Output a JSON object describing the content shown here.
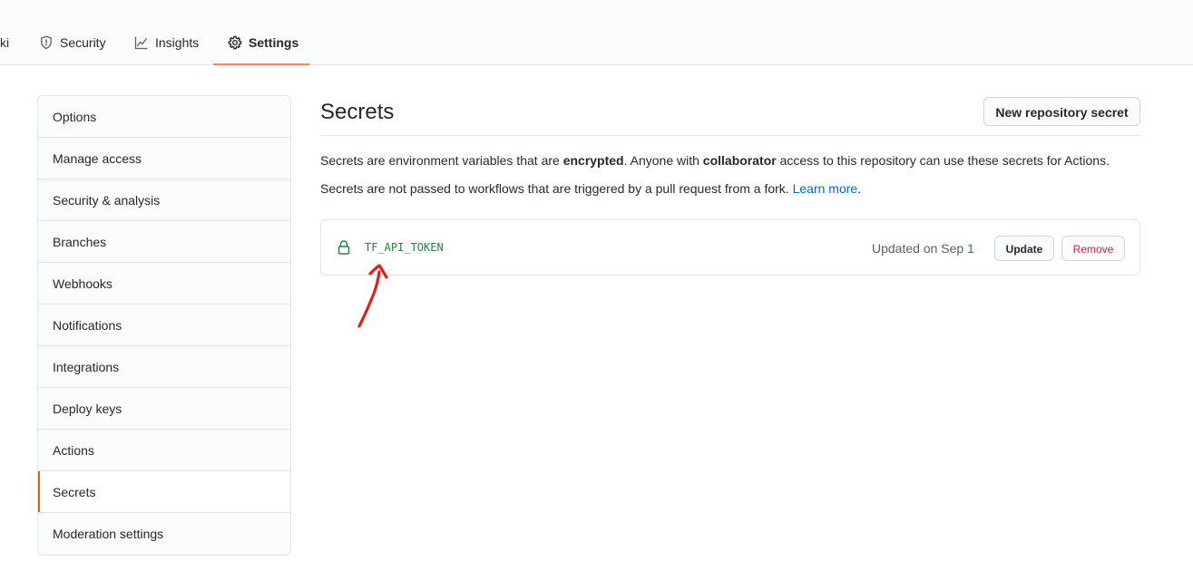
{
  "tabs": [
    {
      "label": "ki",
      "icon": "none",
      "selected": false
    },
    {
      "label": "Security",
      "icon": "shield-icon",
      "selected": false
    },
    {
      "label": "Insights",
      "icon": "graph-icon",
      "selected": false
    },
    {
      "label": "Settings",
      "icon": "gear-icon",
      "selected": true
    }
  ],
  "sidebar": {
    "items": [
      {
        "label": "Options"
      },
      {
        "label": "Manage access"
      },
      {
        "label": "Security & analysis"
      },
      {
        "label": "Branches"
      },
      {
        "label": "Webhooks"
      },
      {
        "label": "Notifications"
      },
      {
        "label": "Integrations"
      },
      {
        "label": "Deploy keys"
      },
      {
        "label": "Actions"
      },
      {
        "label": "Secrets",
        "selected": true
      },
      {
        "label": "Moderation settings"
      }
    ]
  },
  "main": {
    "title": "Secrets",
    "new_button": "New repository secret",
    "desc1": {
      "part1": "Secrets are environment variables that are ",
      "bold1": "encrypted",
      "part2": ". Anyone with ",
      "bold2": "collaborator",
      "part3": " access to this repository can use these secrets for Actions."
    },
    "desc2": {
      "text": "Secrets are not passed to workflows that are triggered by a pull request from a fork. ",
      "link": "Learn more",
      "end": "."
    },
    "secrets": [
      {
        "name": "TF_API_TOKEN",
        "updated": "Updated on Sep 1",
        "update_label": "Update",
        "remove_label": "Remove"
      }
    ]
  },
  "annotation": {
    "type": "red-arrow",
    "color": "#e02020"
  },
  "colors": {
    "accent_underline": "#f9826c",
    "secret_name": "#22863a",
    "remove": "#cb2431",
    "link": "#0366d6"
  }
}
